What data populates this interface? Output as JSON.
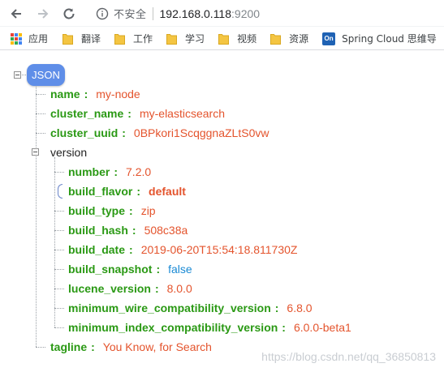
{
  "browser": {
    "security_label": "不安全",
    "url_host": "192.168.0.118",
    "url_port": ":9200"
  },
  "bookmarks": [
    {
      "label": "应用",
      "icon": "apps-grid-icon"
    },
    {
      "label": "翻译",
      "icon": "folder-icon"
    },
    {
      "label": "工作",
      "icon": "folder-icon"
    },
    {
      "label": "学习",
      "icon": "folder-icon"
    },
    {
      "label": "视频",
      "icon": "folder-icon"
    },
    {
      "label": "资源",
      "icon": "folder-icon"
    },
    {
      "label": "Spring Cloud 思维导",
      "icon": "on-site-icon",
      "icon_text": "On"
    }
  ],
  "json": {
    "root_label": "JSON",
    "name": {
      "key": "name",
      "value": "my-node"
    },
    "cluster_name": {
      "key": "cluster_name",
      "value": "my-elasticsearch"
    },
    "cluster_uuid": {
      "key": "cluster_uuid",
      "value": "0BPkori1ScqggnaZLtS0vw"
    },
    "version": {
      "key": "version",
      "number": {
        "key": "number",
        "value": "7.2.0"
      },
      "build_flavor": {
        "key": "build_flavor",
        "value": "default"
      },
      "build_type": {
        "key": "build_type",
        "value": "zip"
      },
      "build_hash": {
        "key": "build_hash",
        "value": "508c38a"
      },
      "build_date": {
        "key": "build_date",
        "value": "2019-06-20T15:54:18.811730Z"
      },
      "build_snapshot": {
        "key": "build_snapshot",
        "value": "false"
      },
      "lucene_version": {
        "key": "lucene_version",
        "value": "8.0.0"
      },
      "minimum_wire_compatibility_version": {
        "key": "minimum_wire_compatibility_version",
        "value": "6.8.0"
      },
      "minimum_index_compatibility_version": {
        "key": "minimum_index_compatibility_version",
        "value": "6.0.0-beta1"
      }
    },
    "tagline": {
      "key": "tagline",
      "value": "You Know, for Search"
    }
  },
  "watermark": "https://blog.csdn.net/qq_36850813",
  "colors": {
    "key": "#2a9914",
    "string": "#e4542d",
    "boolean": "#1a8ad4",
    "root_badge": "#5f8ee8",
    "folder": "#f4c542"
  }
}
